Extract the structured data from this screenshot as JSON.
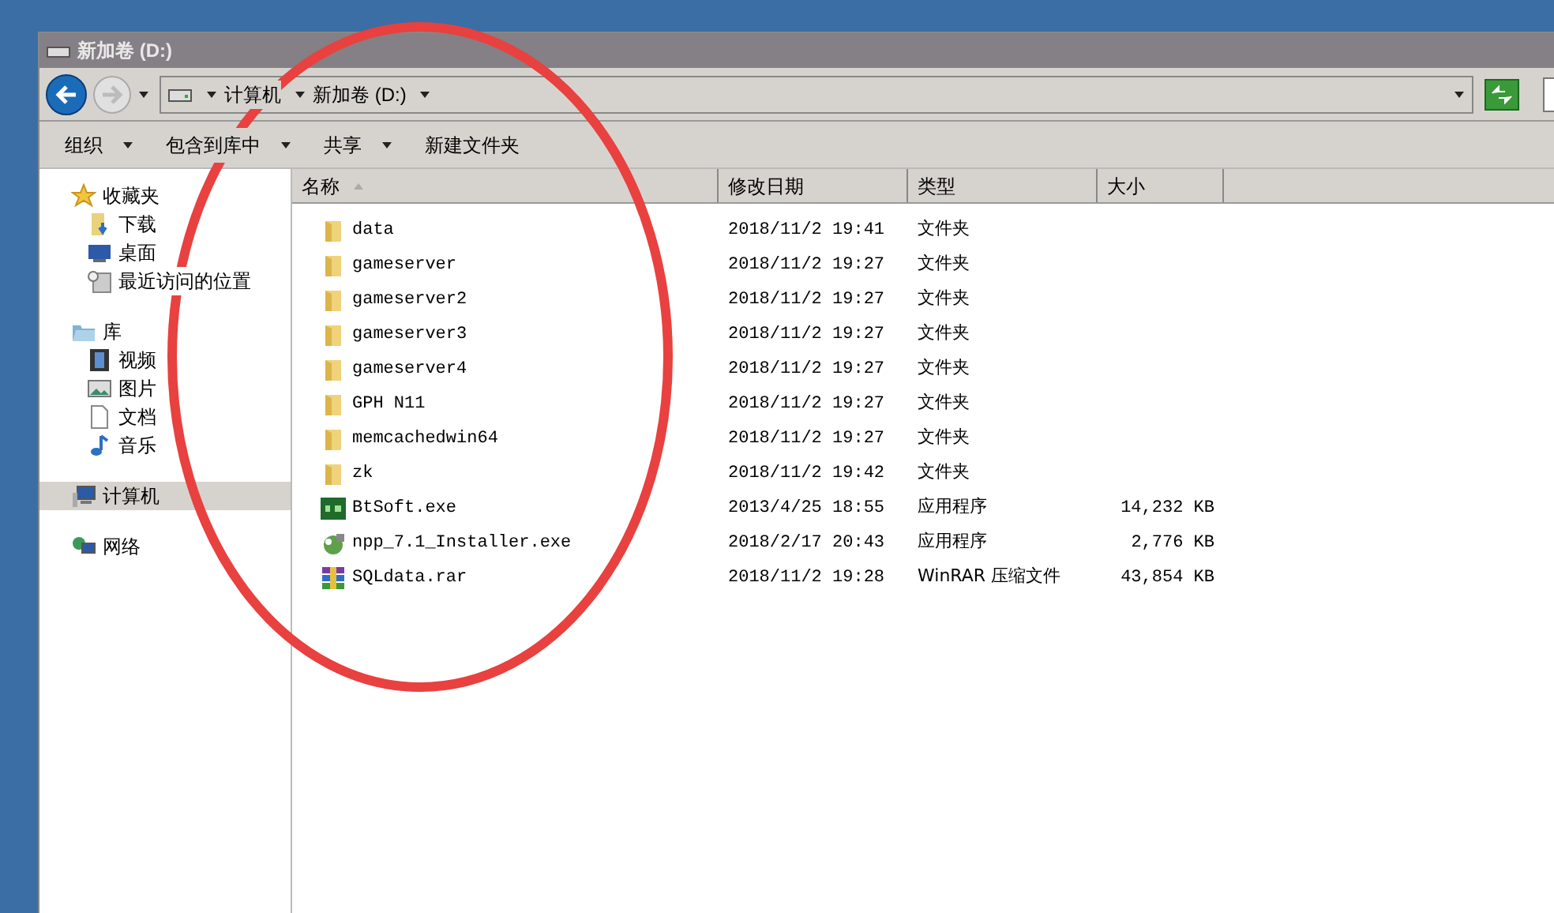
{
  "window": {
    "title": "新加卷 (D:)"
  },
  "address_bar": {
    "crumbs": [
      "计算机",
      "新加卷 (D:)"
    ]
  },
  "toolbar": [
    {
      "label": "组织",
      "dropdown": true
    },
    {
      "label": "包含到库中",
      "dropdown": true
    },
    {
      "label": "共享",
      "dropdown": true
    },
    {
      "label": "新建文件夹",
      "dropdown": false
    }
  ],
  "sidebar": {
    "groups": [
      {
        "label": "收藏夹",
        "kind": "star",
        "selected": false,
        "children": [
          {
            "label": "下载",
            "kind": "download"
          },
          {
            "label": "桌面",
            "kind": "desktop"
          },
          {
            "label": "最近访问的位置",
            "kind": "recent"
          }
        ]
      },
      {
        "label": "库",
        "kind": "library",
        "selected": false,
        "children": [
          {
            "label": "视频",
            "kind": "video"
          },
          {
            "label": "图片",
            "kind": "picture"
          },
          {
            "label": "文档",
            "kind": "document"
          },
          {
            "label": "音乐",
            "kind": "music"
          }
        ]
      },
      {
        "label": "计算机",
        "kind": "computer",
        "selected": true
      },
      {
        "label": "网络",
        "kind": "network",
        "selected": false
      }
    ]
  },
  "table": {
    "columns": [
      "名称",
      "修改日期",
      "类型",
      "大小"
    ],
    "rows": [
      {
        "kind": "folder",
        "name": "data",
        "modified": "2018/11/2 19:41",
        "type": "文件夹"
      },
      {
        "kind": "folder",
        "name": "gameserver",
        "modified": "2018/11/2 19:27",
        "type": "文件夹"
      },
      {
        "kind": "folder",
        "name": "gameserver2",
        "modified": "2018/11/2 19:27",
        "type": "文件夹"
      },
      {
        "kind": "folder",
        "name": "gameserver3",
        "modified": "2018/11/2 19:27",
        "type": "文件夹"
      },
      {
        "kind": "folder",
        "name": "gameserver4",
        "modified": "2018/11/2 19:27",
        "type": "文件夹"
      },
      {
        "kind": "folder",
        "name": "GPH N11",
        "modified": "2018/11/2 19:27",
        "type": "文件夹"
      },
      {
        "kind": "folder",
        "name": "memcachedwin64",
        "modified": "2018/11/2 19:27",
        "type": "文件夹"
      },
      {
        "kind": "folder",
        "name": "zk",
        "modified": "2018/11/2 19:42",
        "type": "文件夹"
      },
      {
        "kind": "bt",
        "name": "BtSoft.exe",
        "modified": "2013/4/25 18:55",
        "type": "应用程序",
        "size": "14,232 KB"
      },
      {
        "kind": "installer",
        "name": "npp_7.1_Installer.exe",
        "modified": "2018/2/17 20:43",
        "type": "应用程序",
        "size": "2,776 KB"
      },
      {
        "kind": "rar",
        "name": "SQLdata.rar",
        "modified": "2018/11/2 19:28",
        "type": "WinRAR 压缩文件",
        "size": "43,854 KB"
      }
    ]
  }
}
